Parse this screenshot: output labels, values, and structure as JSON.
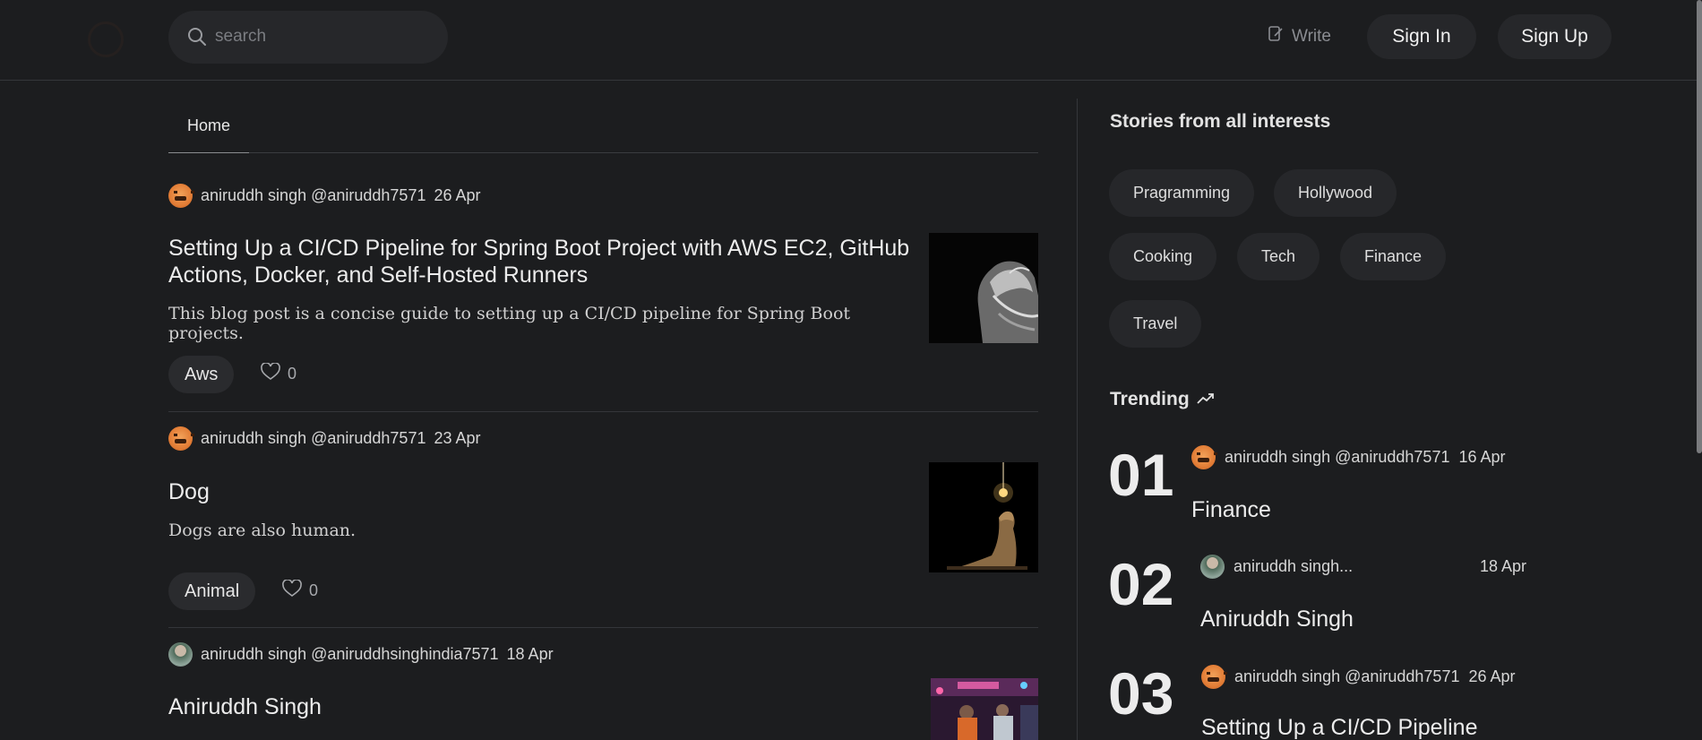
{
  "header": {
    "search_placeholder": "search",
    "write_label": "Write",
    "signin_label": "Sign In",
    "signup_label": "Sign Up"
  },
  "tabs": [
    {
      "label": "Home"
    }
  ],
  "posts": [
    {
      "author": "aniruddh singh @aniruddh7571",
      "date": "26 Apr",
      "title": "Setting Up a CI/CD Pipeline for Spring Boot Project with AWS EC2, GitHub Actions, Docker, and Self-Hosted Runners",
      "description": "This blog post is a concise guide to setting up a CI/CD pipeline for Spring Boot projects.",
      "tag": "Aws",
      "likes": "0"
    },
    {
      "author": "aniruddh singh @aniruddh7571",
      "date": "23 Apr",
      "title": "Dog",
      "description": "Dogs are also human.",
      "tag": "Animal",
      "likes": "0"
    },
    {
      "author": "aniruddh singh @aniruddhsinghindia7571",
      "date": "18 Apr",
      "title": "Aniruddh Singh"
    }
  ],
  "sidebar": {
    "interests_title": "Stories from all interests",
    "topics": [
      "Pragramming",
      "Hollywood",
      "Cooking",
      "Tech",
      "Finance",
      "Travel"
    ],
    "trending_title": "Trending",
    "trending": [
      {
        "num": "01",
        "author": "aniruddh singh @aniruddh7571",
        "date": "16 Apr",
        "title": "Finance"
      },
      {
        "num": "02",
        "author": "aniruddh singh...",
        "date": "18 Apr",
        "title": "Aniruddh Singh"
      },
      {
        "num": "03",
        "author": "aniruddh singh @aniruddh7571",
        "date": "26 Apr",
        "title": "Setting Up a CI/CD Pipeline"
      }
    ]
  }
}
